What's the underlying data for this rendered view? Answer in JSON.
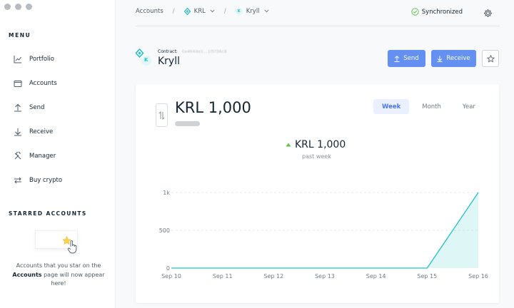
{
  "window": {
    "controls": [
      "close",
      "minimize",
      "maximize"
    ]
  },
  "sidebar": {
    "menu_title": "MENU",
    "items": [
      {
        "label": "Portfolio",
        "icon": "portfolio-chart-icon"
      },
      {
        "label": "Accounts",
        "icon": "wallet-icon"
      },
      {
        "label": "Send",
        "icon": "arrow-up-icon"
      },
      {
        "label": "Receive",
        "icon": "arrow-down-icon"
      },
      {
        "label": "Manager",
        "icon": "tools-icon"
      },
      {
        "label": "Buy crypto",
        "icon": "exchange-icon"
      }
    ],
    "starred_title": "STARRED ACCOUNTS",
    "starred_empty_pre": "Accounts that you star on the",
    "starred_empty_bold": "Accounts",
    "starred_empty_post": "page will now appear here!"
  },
  "topbar": {
    "breadcrumb": {
      "root": "Accounts",
      "sep1": "/",
      "currency": "KRL",
      "sep2": "/",
      "account": "Kryll"
    },
    "sync_status": "Synchronized"
  },
  "account": {
    "contract_label": "Contract:",
    "contract_value": "0x464de1...1f5f36c8",
    "name": "Kryll",
    "token_badge": "K"
  },
  "actions": {
    "send_label": "Send",
    "receive_label": "Receive"
  },
  "balance": {
    "amount": "KRL 1,000",
    "delta_amount": "KRL 1,000",
    "delta_label": "past week"
  },
  "ranges": {
    "items": [
      "Week",
      "Month",
      "Year"
    ],
    "selected": "Week"
  },
  "colors": {
    "accent": "#6490f1",
    "line": "#1fc1c3",
    "sync_ok": "#66be54",
    "delta_up": "#66be54",
    "star": "#ffd24a"
  },
  "chart_data": {
    "type": "area",
    "x": [
      "Sep 10",
      "Sep 11",
      "Sep 12",
      "Sep 13",
      "Sep 14",
      "Sep 15",
      "Sep 16"
    ],
    "values": [
      0,
      0,
      0,
      0,
      0,
      0,
      1000
    ],
    "yticks": [
      "0",
      "500",
      "1k"
    ],
    "ylim": [
      0,
      1000
    ],
    "grid": true
  }
}
